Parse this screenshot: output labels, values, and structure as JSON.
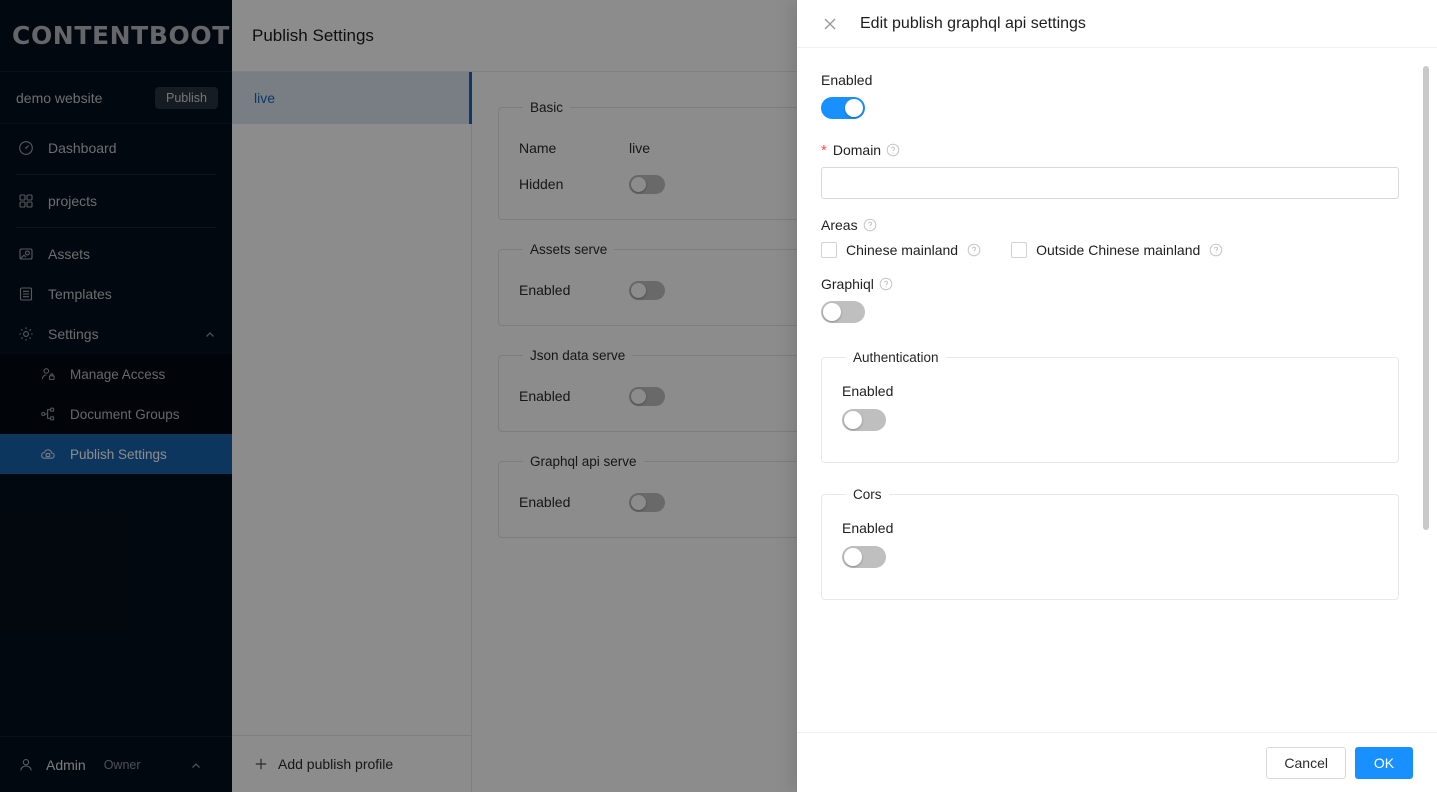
{
  "sidebar": {
    "brand": "CONTENTBOOT",
    "site": {
      "name": "demo website",
      "publish_label": "Publish"
    },
    "items": [
      {
        "label": "Dashboard",
        "icon": "gauge-icon"
      },
      {
        "label": "projects",
        "icon": "grid-icon"
      },
      {
        "label": "Assets",
        "icon": "image-icon"
      },
      {
        "label": "Templates",
        "icon": "template-icon"
      },
      {
        "label": "Settings",
        "icon": "gear-icon"
      },
      {
        "label": "Manage Access",
        "icon": "user-lock-icon"
      },
      {
        "label": "Document Groups",
        "icon": "node-share-icon"
      },
      {
        "label": "Publish Settings",
        "icon": "cloud-icon"
      }
    ],
    "user": {
      "name": "Admin",
      "role": "Owner"
    }
  },
  "main": {
    "title": "Publish Settings",
    "profiles": [
      {
        "label": "live",
        "selected": true
      }
    ],
    "add_profile_label": "Add publish profile",
    "sections": [
      {
        "legend": "Basic",
        "rows": [
          {
            "key": "Name",
            "type": "text",
            "value": "live"
          },
          {
            "key": "Hidden",
            "type": "toggle",
            "on": false
          }
        ]
      },
      {
        "legend": "Assets serve",
        "rows": [
          {
            "key": "Enabled",
            "type": "toggle",
            "on": false
          }
        ]
      },
      {
        "legend": "Json data serve",
        "rows": [
          {
            "key": "Enabled",
            "type": "toggle",
            "on": false
          }
        ]
      },
      {
        "legend": "Graphql api serve",
        "rows": [
          {
            "key": "Enabled",
            "type": "toggle",
            "on": false
          }
        ]
      }
    ]
  },
  "drawer": {
    "title": "Edit publish graphql api settings",
    "close_icon": "close-icon",
    "enabled_label": "Enabled",
    "enabled_on": true,
    "domain": {
      "label": "Domain",
      "required": true,
      "value": "",
      "placeholder": "",
      "help_icon": "question-circle-icon"
    },
    "areas": {
      "label": "Areas",
      "help_icon": "question-circle-icon",
      "options": [
        {
          "label": "Chinese mainland",
          "checked": false
        },
        {
          "label": "Outside Chinese mainland",
          "checked": false
        }
      ]
    },
    "graphiql": {
      "label": "Graphiql",
      "on": false,
      "help_icon": "question-circle-icon"
    },
    "authentication": {
      "legend": "Authentication",
      "enabled_label": "Enabled",
      "on": false
    },
    "cors": {
      "legend": "Cors",
      "enabled_label": "Enabled",
      "on": false
    },
    "footer": {
      "cancel": "Cancel",
      "ok": "OK"
    }
  },
  "colors": {
    "accent_blue": "#1890ff",
    "sidebar_bg": "#050f1c",
    "sidebar_active": "#1963ac",
    "profile_selected": "#dce5f0",
    "required_red": "#ff4d4f"
  }
}
